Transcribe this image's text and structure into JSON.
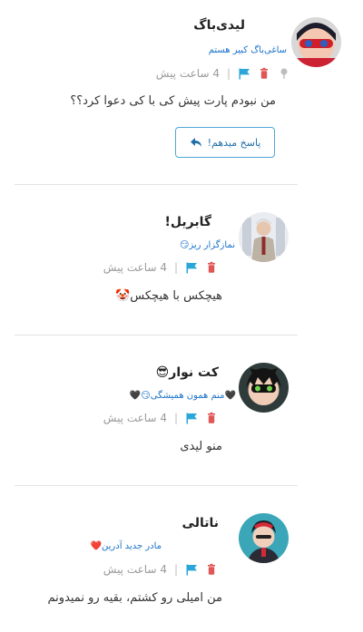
{
  "comments": [
    {
      "name": "لیدی‌باگ",
      "subtitle": "ساغی‌باگ کبیر هستم",
      "time": "4 ساعت پیش",
      "body": "من نبودم پارت پیش کی با کی دعوا کرد؟؟",
      "icons": [
        "pin-icon",
        "trash-icon",
        "flag-icon"
      ],
      "reply_label": "پاسخ میدهم!"
    },
    {
      "name": "گابریل!",
      "subtitle": "نمازگزار ریز😏",
      "time": "4 ساعت پیش",
      "body": "هیچکس با هیچکس🤡",
      "icons": [
        "trash-icon",
        "flag-icon"
      ]
    },
    {
      "name": "کت نوار😎",
      "subtitle": "🖤منم همون همیشگی😏🖤",
      "time": "4 ساعت پیش",
      "body": "منو لیدی",
      "icons": [
        "trash-icon",
        "flag-icon"
      ]
    },
    {
      "name": "ناتالی",
      "subtitle": "مادر جدید آدرین❤️",
      "time": "4 ساعت پیش",
      "body": "من امیلی رو کشتم، بقیه رو نمیدونم",
      "icons": [
        "trash-icon",
        "flag-icon"
      ]
    }
  ],
  "meta_separator": "|",
  "colors": {
    "accent": "#1a73c9",
    "trash": "#e05555",
    "flag": "#2aa7d8",
    "pin": "#bdbdbd",
    "divider": "#e3e3e3"
  }
}
